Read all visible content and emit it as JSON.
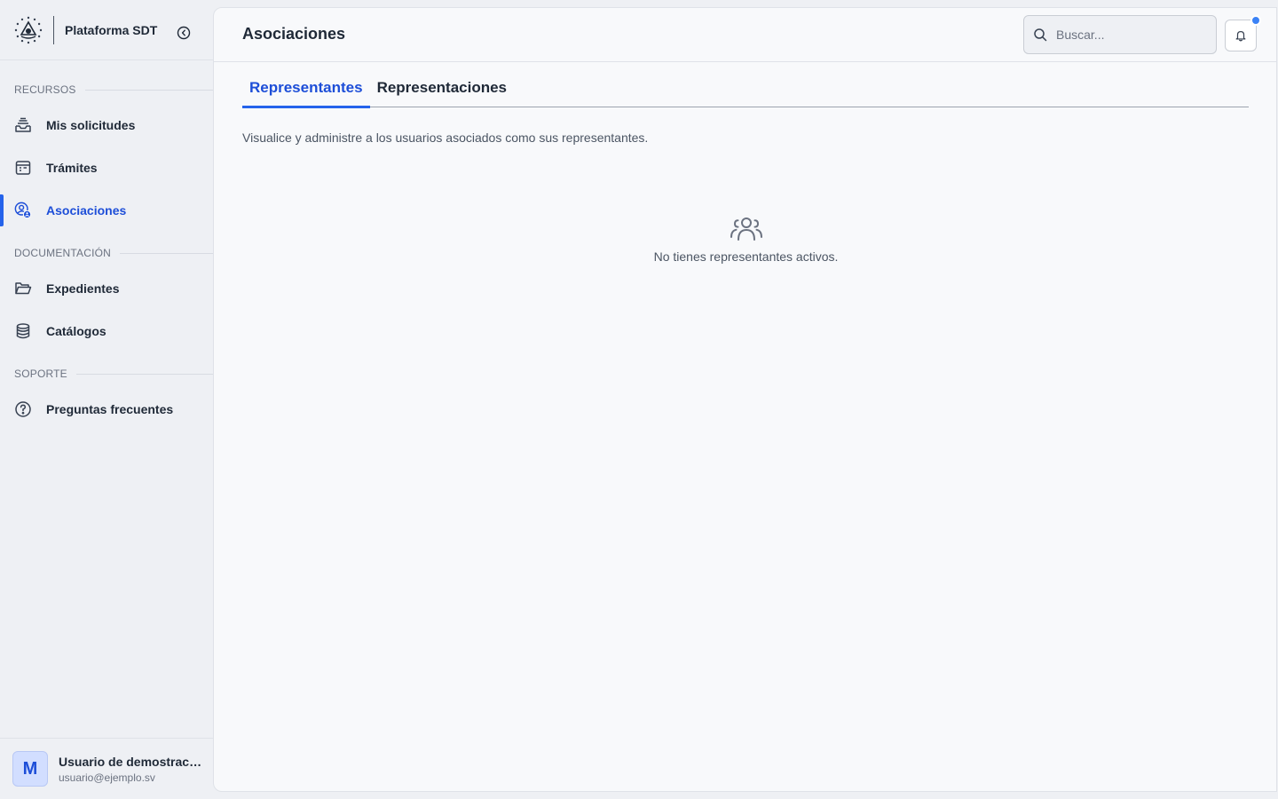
{
  "sidebar": {
    "app_title": "Plataforma SDT",
    "sections": {
      "recursos": "RECURSOS",
      "documentacion": "DOCUMENTACIÓN",
      "soporte": "SOPORTE"
    },
    "items": [
      {
        "label": "Mis solicitudes",
        "icon": "inbox-stack-icon"
      },
      {
        "label": "Trámites",
        "icon": "calendar-table-icon"
      },
      {
        "label": "Asociaciones",
        "icon": "user-badge-icon",
        "active": true
      },
      {
        "label": "Expedientes",
        "icon": "folder-open-icon"
      },
      {
        "label": "Catálogos",
        "icon": "database-icon"
      },
      {
        "label": "Preguntas frecuentes",
        "icon": "question-circle-icon"
      }
    ],
    "user": {
      "initial": "M",
      "name": "Usuario de demostración",
      "email": "usuario@ejemplo.sv"
    }
  },
  "header": {
    "title": "Asociaciones",
    "search_placeholder": "Buscar..."
  },
  "tabs": [
    {
      "label": "Representantes",
      "active": true
    },
    {
      "label": "Representaciones",
      "active": false
    }
  ],
  "content": {
    "description": "Visualice y administre a los usuarios asociados como sus representantes.",
    "empty_message": "No tienes representantes activos."
  },
  "colors": {
    "accent": "#2563eb",
    "active_text": "#1d4ed8",
    "notification_dot": "#3b82f6"
  }
}
